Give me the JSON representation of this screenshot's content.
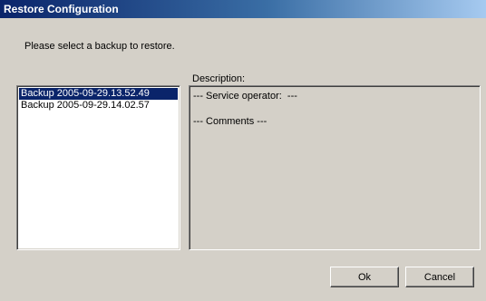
{
  "window": {
    "title": "Restore Configuration"
  },
  "dialog": {
    "prompt": "Please select a backup to restore.",
    "description_label": "Description:"
  },
  "backups": {
    "items": [
      {
        "label": "Backup 2005-09-29.13.52.49",
        "selected": true
      },
      {
        "label": "Backup 2005-09-29.14.02.57",
        "selected": false
      }
    ]
  },
  "description": {
    "service_operator": "--- Service operator:  ---",
    "comments": "--- Comments ---"
  },
  "buttons": {
    "ok": "Ok",
    "cancel": "Cancel"
  },
  "colors": {
    "face": "#d4d0c8",
    "title_start": "#0a246a",
    "title_end": "#a6caf0",
    "selection": "#0a246a"
  }
}
